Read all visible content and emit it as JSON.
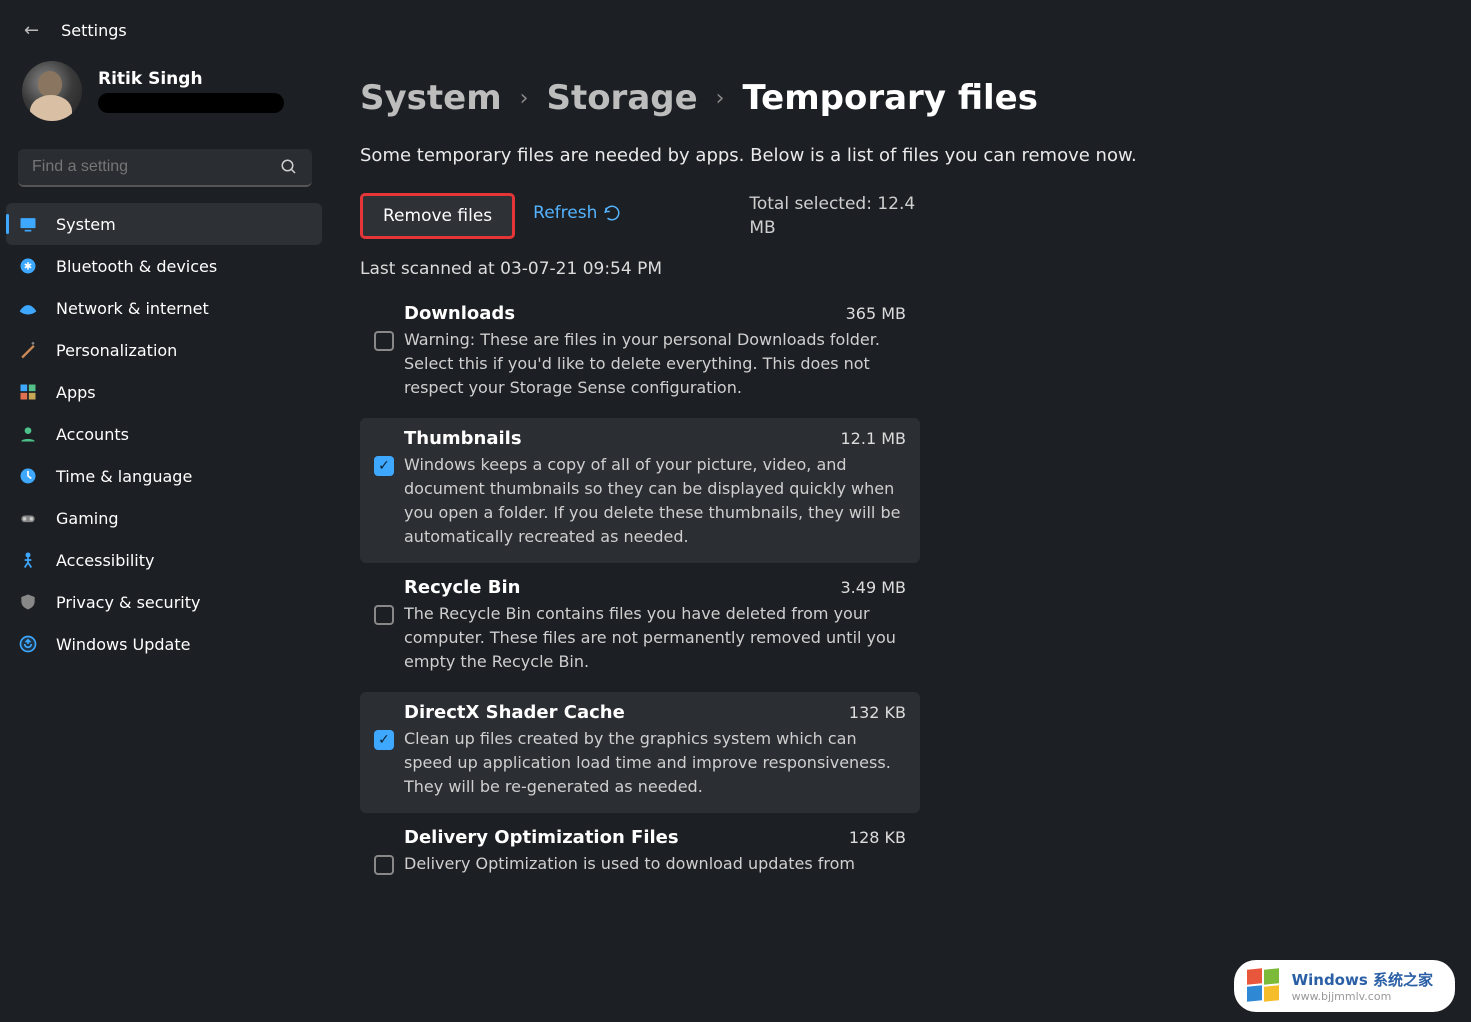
{
  "app_title": "Settings",
  "user": {
    "name": "Ritik Singh"
  },
  "search": {
    "placeholder": "Find a setting"
  },
  "sidebar": {
    "items": [
      {
        "label": "System",
        "active": true
      },
      {
        "label": "Bluetooth & devices"
      },
      {
        "label": "Network & internet"
      },
      {
        "label": "Personalization"
      },
      {
        "label": "Apps"
      },
      {
        "label": "Accounts"
      },
      {
        "label": "Time & language"
      },
      {
        "label": "Gaming"
      },
      {
        "label": "Accessibility"
      },
      {
        "label": "Privacy & security"
      },
      {
        "label": "Windows Update"
      }
    ]
  },
  "breadcrumb": {
    "c1": "System",
    "c2": "Storage",
    "c3": "Temporary files"
  },
  "main": {
    "description": "Some temporary files are needed by apps. Below is a list of files you can remove now.",
    "remove_label": "Remove files",
    "refresh_label": "Refresh",
    "total_selected": "Total selected: 12.4 MB",
    "last_scanned": "Last scanned at 03-07-21 09:54 PM",
    "files": [
      {
        "name": "Downloads",
        "size": "365 MB",
        "desc": "Warning: These are files in your personal Downloads folder. Select this if you'd like to delete everything. This does not respect your Storage Sense configuration.",
        "checked": false
      },
      {
        "name": "Thumbnails",
        "size": "12.1 MB",
        "desc": "Windows keeps a copy of all of your picture, video, and document thumbnails so they can be displayed quickly when you open a folder. If you delete these thumbnails, they will be automatically recreated as needed.",
        "checked": true
      },
      {
        "name": "Recycle Bin",
        "size": "3.49 MB",
        "desc": "The Recycle Bin contains files you have deleted from your computer. These files are not permanently removed until you empty the Recycle Bin.",
        "checked": false
      },
      {
        "name": "DirectX Shader Cache",
        "size": "132 KB",
        "desc": "Clean up files created by the graphics system which can speed up application load time and improve responsiveness. They will be re-generated as needed.",
        "checked": true
      },
      {
        "name": "Delivery Optimization Files",
        "size": "128 KB",
        "desc": "Delivery Optimization is used to download updates from",
        "checked": false
      }
    ]
  },
  "watermark": {
    "line1": "Windows 系统之家",
    "line2": "www.bjjmmlv.com"
  }
}
